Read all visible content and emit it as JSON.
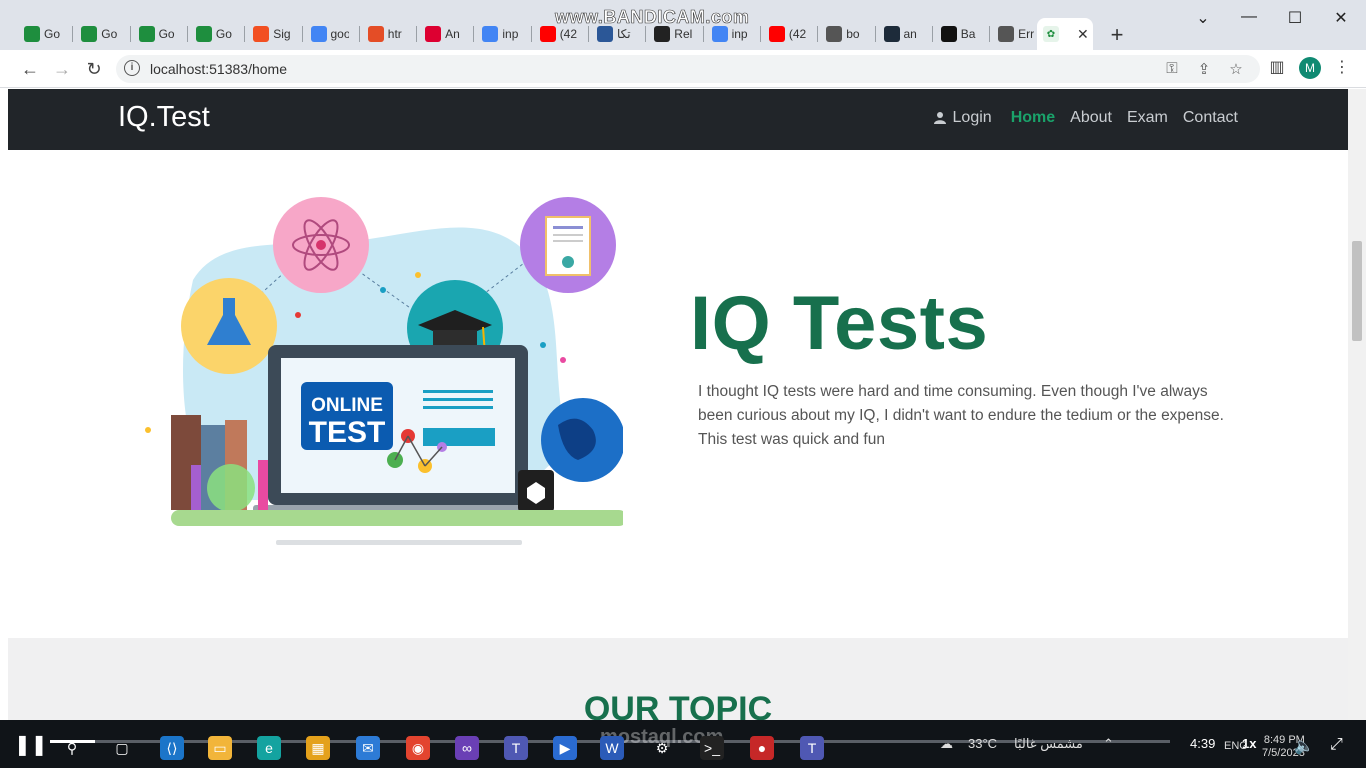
{
  "browser": {
    "recorder_watermark": "www.BANDICAM.com",
    "tabs": [
      {
        "label": "Go",
        "icon": "google-classroom-icon",
        "color": "#1e8e3e"
      },
      {
        "label": "Go",
        "icon": "google-classroom-icon",
        "color": "#1e8e3e"
      },
      {
        "label": "Go",
        "icon": "google-classroom-icon",
        "color": "#1e8e3e"
      },
      {
        "label": "Go",
        "icon": "google-classroom-icon",
        "color": "#1e8e3e"
      },
      {
        "label": "Sig",
        "icon": "microsoft-icon",
        "color": "#f25022"
      },
      {
        "label": "goo",
        "icon": "google-icon",
        "color": "#4285f4"
      },
      {
        "label": "htr",
        "icon": "html-icon",
        "color": "#e44d26"
      },
      {
        "label": "An",
        "icon": "angular-icon",
        "color": "#dd0031"
      },
      {
        "label": "inp",
        "icon": "google-icon",
        "color": "#4285f4"
      },
      {
        "label": "(42",
        "icon": "youtube-icon",
        "color": "#ff0000"
      },
      {
        "label": "تكا",
        "icon": "e-icon",
        "color": "#2b5797"
      },
      {
        "label": "Rel",
        "icon": "github-icon",
        "color": "#222222"
      },
      {
        "label": "inp",
        "icon": "google-icon",
        "color": "#4285f4"
      },
      {
        "label": "(42",
        "icon": "youtube-icon",
        "color": "#ff0000"
      },
      {
        "label": "bo",
        "icon": "globe-icon",
        "color": "#555555"
      },
      {
        "label": "an",
        "icon": "page-icon",
        "color": "#1d2b3a"
      },
      {
        "label": "Ba",
        "icon": "record-icon",
        "color": "#111111"
      },
      {
        "label": "Err",
        "icon": "globe-icon",
        "color": "#555555"
      }
    ],
    "active_tab": {
      "icon": "app-icon"
    },
    "url": "localhost:51383/home",
    "profile_initial": "M"
  },
  "site": {
    "brand": "IQ.Test",
    "nav": {
      "login": "Login",
      "home": "Home",
      "about": "About",
      "exam": "Exam",
      "contact": "Contact"
    },
    "hero": {
      "title": "IQ Tests",
      "text": "I thought IQ tests were hard and time consuming. Even though I've always been curious about my IQ, I didn't want to endure the tedium or the expense. This test was quick and fun",
      "illustration_label_1": "ONLINE",
      "illustration_label_2": "TEST"
    },
    "topic_heading": "OUR TOPIC"
  },
  "player": {
    "progress_fraction": 0.04,
    "watermark": "mostaql.com",
    "weather": "33°C",
    "weather_desc": "مشمس غالبًا",
    "time_played": "4:39",
    "speed": "1x",
    "lang": "ENG",
    "clock_time": "8:49 PM",
    "clock_date": "7/5/2023"
  },
  "colors": {
    "accent_green": "#17704d",
    "nav_active": "#1aa26a",
    "navbar_bg": "#212529"
  }
}
